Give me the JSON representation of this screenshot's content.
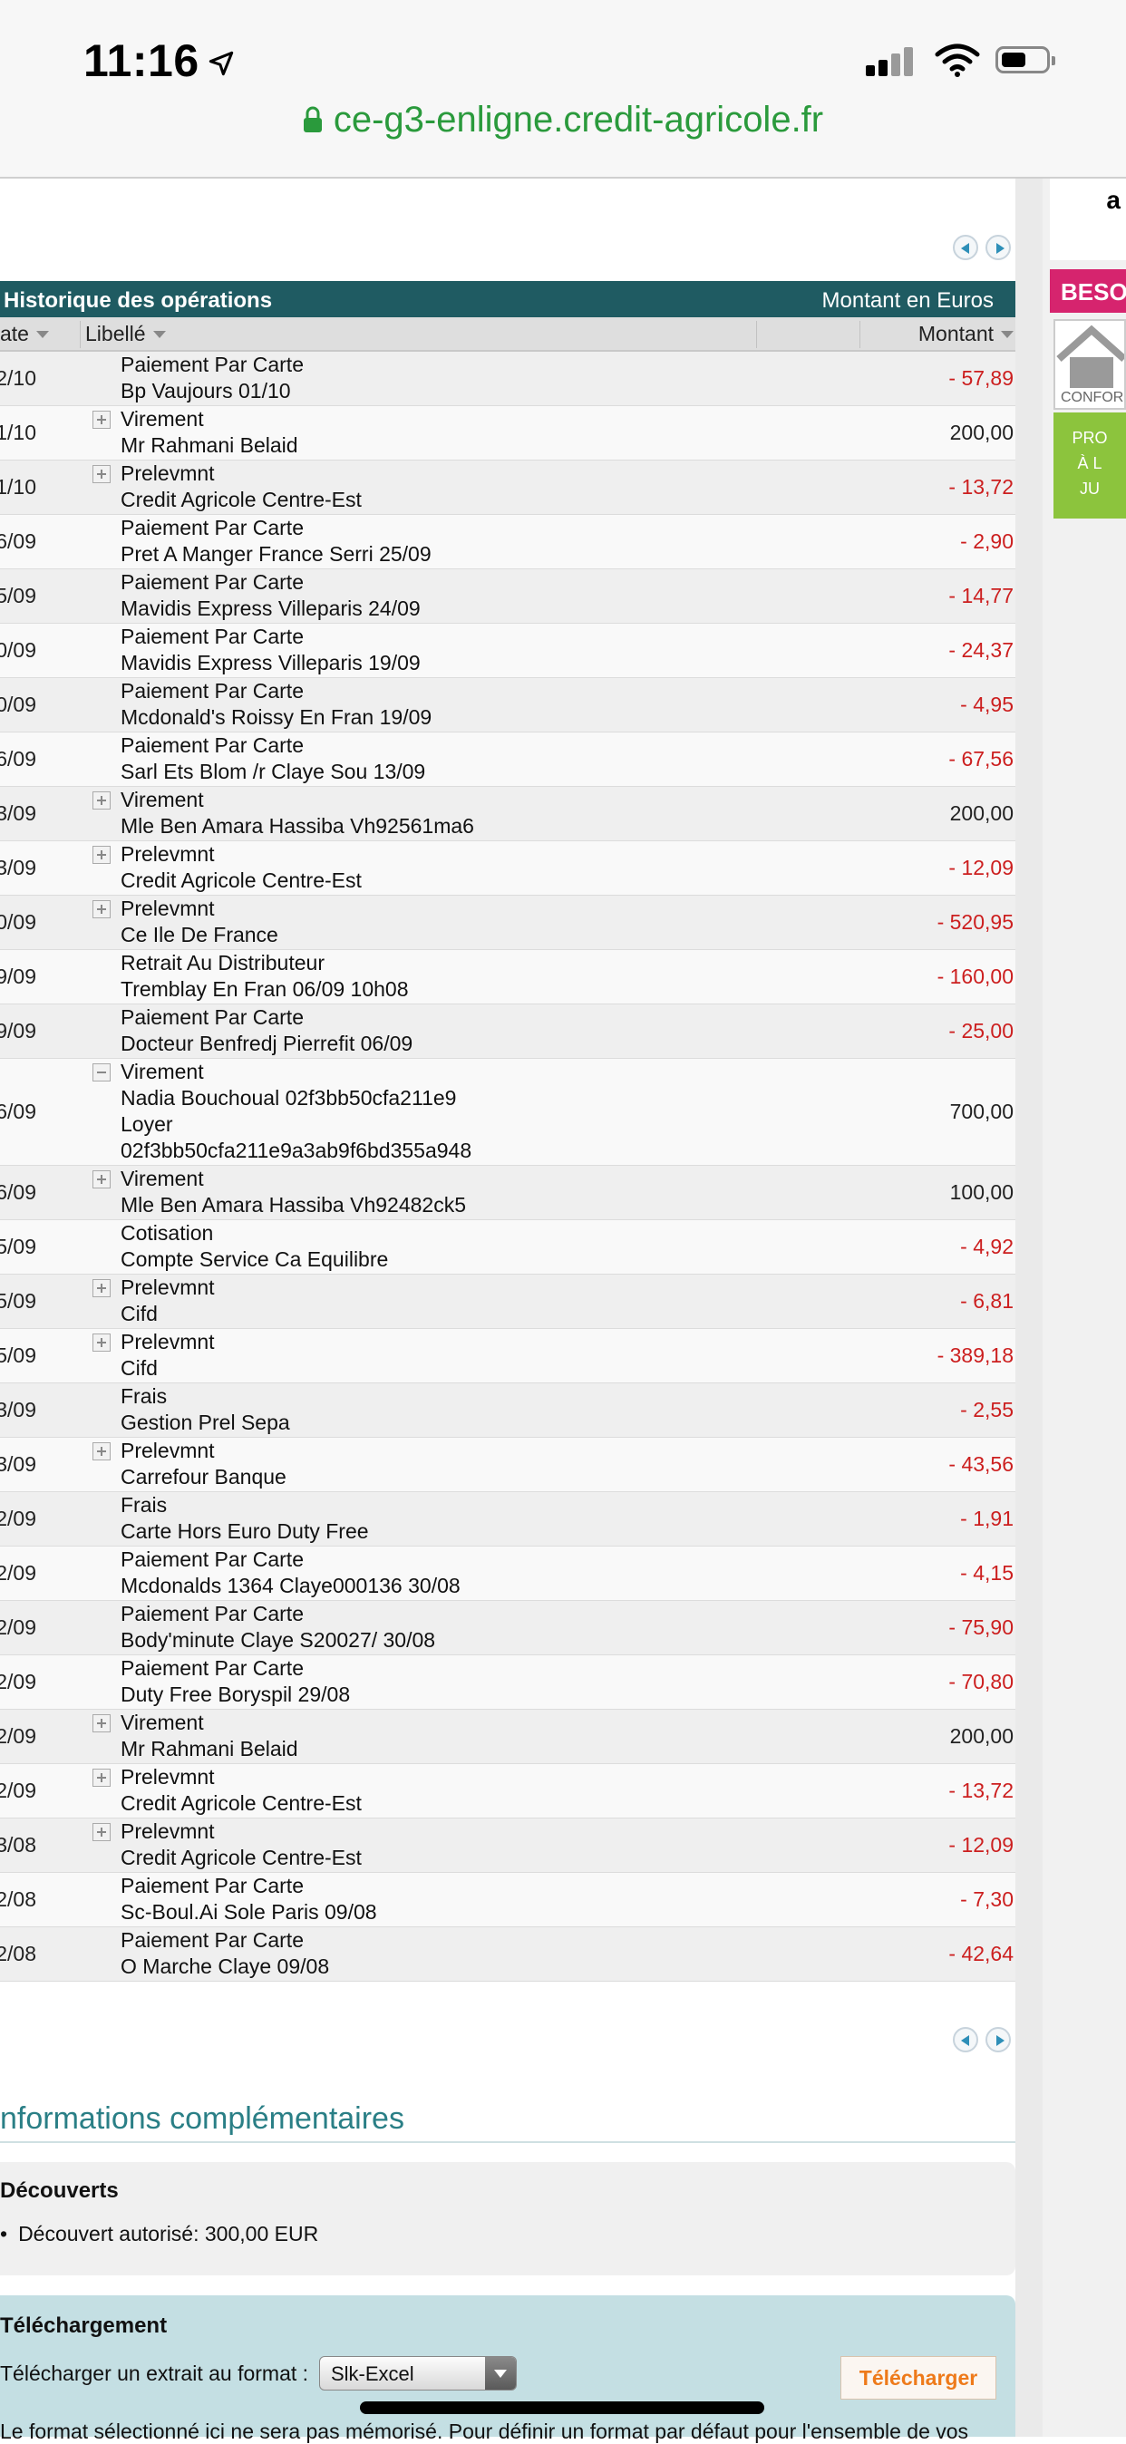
{
  "status_bar": {
    "time": "11:16"
  },
  "browser": {
    "url": "ce-g3-enligne.credit-agricole.fr"
  },
  "right_panel": {
    "top_text": "a",
    "besoin": "BESO",
    "home_label": "CONFOR",
    "promo_lines": [
      "PRO",
      "À L",
      "JU"
    ]
  },
  "table": {
    "title": "Historique des opérations",
    "currency_note": "Montant en Euros",
    "columns": {
      "date": "ate",
      "label": "Libellé",
      "amount": "Montant"
    },
    "rows": [
      {
        "date": "2/10",
        "l1": "Paiement Par Carte",
        "l2": "Bp Vaujours 01/10",
        "amount": "- 57,89",
        "neg": true,
        "plus": false
      },
      {
        "date": "1/10",
        "l1": "Virement",
        "l2": "Mr Rahmani Belaid",
        "amount": "200,00",
        "neg": false,
        "plus": true
      },
      {
        "date": "1/10",
        "l1": "Prelevmnt",
        "l2": "Credit Agricole Centre-Est",
        "amount": "- 13,72",
        "neg": true,
        "plus": true
      },
      {
        "date": "6/09",
        "l1": "Paiement Par Carte",
        "l2": "Pret A Manger France Serri 25/09",
        "amount": "- 2,90",
        "neg": true,
        "plus": false
      },
      {
        "date": "5/09",
        "l1": "Paiement Par Carte",
        "l2": "Mavidis Express Villeparis 24/09",
        "amount": "- 14,77",
        "neg": true,
        "plus": false
      },
      {
        "date": "0/09",
        "l1": "Paiement Par Carte",
        "l2": "Mavidis Express Villeparis 19/09",
        "amount": "- 24,37",
        "neg": true,
        "plus": false
      },
      {
        "date": "0/09",
        "l1": "Paiement Par Carte",
        "l2": "Mcdonald's Roissy En Fran 19/09",
        "amount": "- 4,95",
        "neg": true,
        "plus": false
      },
      {
        "date": "6/09",
        "l1": "Paiement Par Carte",
        "l2": "Sarl Ets Blom /r Claye Sou 13/09",
        "amount": "- 67,56",
        "neg": true,
        "plus": false
      },
      {
        "date": "3/09",
        "l1": "Virement",
        "l2": "Mle Ben Amara Hassiba Vh92561ma6",
        "amount": "200,00",
        "neg": false,
        "plus": true
      },
      {
        "date": "3/09",
        "l1": "Prelevmnt",
        "l2": "Credit Agricole Centre-Est",
        "amount": "- 12,09",
        "neg": true,
        "plus": true
      },
      {
        "date": "0/09",
        "l1": "Prelevmnt",
        "l2": "Ce Ile De France",
        "amount": "- 520,95",
        "neg": true,
        "plus": true
      },
      {
        "date": "9/09",
        "l1": "Retrait Au Distributeur",
        "l2": "Tremblay En Fran 06/09 10h08",
        "amount": "- 160,00",
        "neg": true,
        "plus": false
      },
      {
        "date": "9/09",
        "l1": "Paiement Par Carte",
        "l2": "Docteur Benfredj Pierrefit 06/09",
        "amount": "- 25,00",
        "neg": true,
        "plus": false
      },
      {
        "date": "6/09",
        "l1": "Virement",
        "l2": "Nadia Bouchoual 02f3bb50cfa211e9",
        "l3": "Loyer",
        "l4": "02f3bb50cfa211e9a3ab9f6bd355a948",
        "amount": "700,00",
        "neg": false,
        "plus": true,
        "open": true
      },
      {
        "date": "6/09",
        "l1": "Virement",
        "l2": "Mle Ben Amara Hassiba Vh92482ck5",
        "amount": "100,00",
        "neg": false,
        "plus": true
      },
      {
        "date": "5/09",
        "l1": "Cotisation",
        "l2": "Compte Service Ca Equilibre",
        "amount": "- 4,92",
        "neg": true,
        "plus": false
      },
      {
        "date": "5/09",
        "l1": "Prelevmnt",
        "l2": "Cifd",
        "amount": "- 6,81",
        "neg": true,
        "plus": true
      },
      {
        "date": "5/09",
        "l1": "Prelevmnt",
        "l2": "Cifd",
        "amount": "- 389,18",
        "neg": true,
        "plus": true
      },
      {
        "date": "3/09",
        "l1": "Frais",
        "l2": "Gestion Prel Sepa",
        "amount": "- 2,55",
        "neg": true,
        "plus": false
      },
      {
        "date": "3/09",
        "l1": "Prelevmnt",
        "l2": "Carrefour Banque",
        "amount": "- 43,56",
        "neg": true,
        "plus": true
      },
      {
        "date": "2/09",
        "l1": "Frais",
        "l2": "Carte Hors Euro Duty Free",
        "amount": "- 1,91",
        "neg": true,
        "plus": false
      },
      {
        "date": "2/09",
        "l1": "Paiement Par Carte",
        "l2": "Mcdonalds 1364 Claye000136 30/08",
        "amount": "- 4,15",
        "neg": true,
        "plus": false
      },
      {
        "date": "2/09",
        "l1": "Paiement Par Carte",
        "l2": "Body'minute Claye S20027/ 30/08",
        "amount": "- 75,90",
        "neg": true,
        "plus": false
      },
      {
        "date": "2/09",
        "l1": "Paiement Par Carte",
        "l2": "Duty Free Boryspil 29/08",
        "amount": "- 70,80",
        "neg": true,
        "plus": false
      },
      {
        "date": "2/09",
        "l1": "Virement",
        "l2": "Mr Rahmani Belaid",
        "amount": "200,00",
        "neg": false,
        "plus": true
      },
      {
        "date": "2/09",
        "l1": "Prelevmnt",
        "l2": "Credit Agricole Centre-Est",
        "amount": "- 13,72",
        "neg": true,
        "plus": true
      },
      {
        "date": "3/08",
        "l1": "Prelevmnt",
        "l2": "Credit Agricole Centre-Est",
        "amount": "- 12,09",
        "neg": true,
        "plus": true
      },
      {
        "date": "2/08",
        "l1": "Paiement Par Carte",
        "l2": "Sc-Boul.Ai Sole Paris 09/08",
        "amount": "- 7,30",
        "neg": true,
        "plus": false
      },
      {
        "date": "2/08",
        "l1": "Paiement Par Carte",
        "l2": "O Marche Claye 09/08",
        "amount": "- 42,64",
        "neg": true,
        "plus": false
      }
    ]
  },
  "info": {
    "title": "nformations complémentaires",
    "decouverts_heading": "Découverts",
    "decouvert_item": "Découvert autorisé: 300,00 EUR",
    "telechargement_heading": "Téléchargement",
    "download_label": "Télécharger un extrait au format :",
    "format_selected": "Slk-Excel",
    "download_button": "Télécharger",
    "cut_text": "Le format sélectionné ici ne sera pas mémorisé. Pour définir un format par défaut pour l'ensemble de vos"
  }
}
